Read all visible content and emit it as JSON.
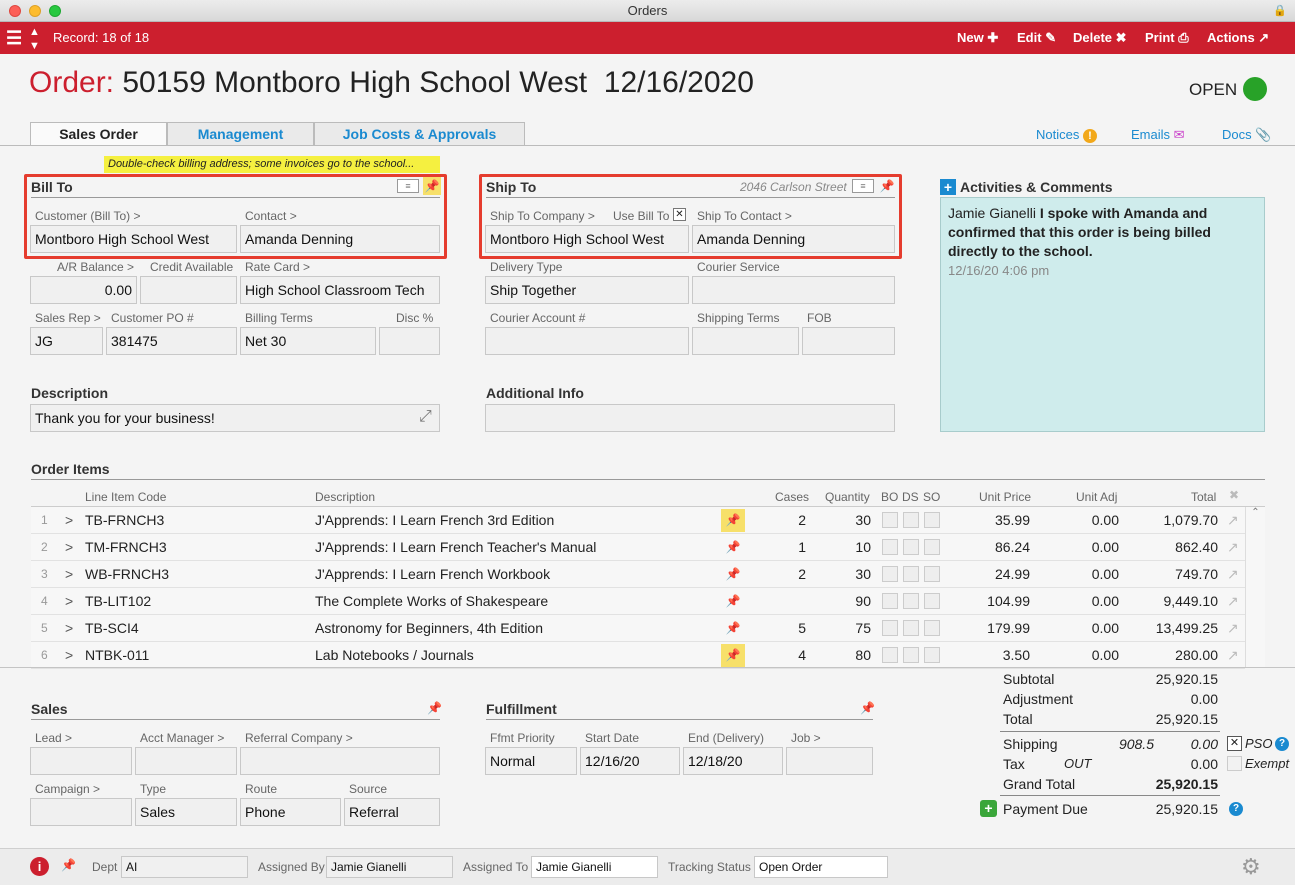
{
  "window": {
    "title": "Orders"
  },
  "toolbar": {
    "record": "Record: 18 of 18",
    "new": "New",
    "edit": "Edit",
    "delete": "Delete",
    "print": "Print",
    "actions": "Actions"
  },
  "header": {
    "prefix": "Order:",
    "title": "50159 Montboro High School West  12/16/2020",
    "status": "OPEN",
    "status_color": "#28a228"
  },
  "tabs": [
    "Sales Order",
    "Management",
    "Job Costs & Approvals"
  ],
  "links": {
    "notices": "Notices",
    "emails": "Emails",
    "docs": "Docs"
  },
  "note": "Double-check billing address; some invoices go to the school...",
  "bill_to": {
    "title": "Bill To",
    "customer_label": "Customer (Bill To) >",
    "customer": "Montboro High School West",
    "contact_label": "Contact >",
    "contact": "Amanda Denning",
    "ar_label": "A/R Balance >",
    "ar": "0.00",
    "credit_label": "Credit Available",
    "credit": "",
    "ratecard_label": "Rate Card >",
    "ratecard": "High School Classroom Tech",
    "salesrep_label": "Sales Rep >",
    "salesrep": "JG",
    "po_label": "Customer PO #",
    "po": "381475",
    "terms_label": "Billing Terms",
    "terms": "Net 30",
    "disc_label": "Disc %",
    "disc": ""
  },
  "ship_to": {
    "title": "Ship To",
    "address": "2046 Carlson Street",
    "company_label": "Ship To Company >",
    "use_bill_label": "Use Bill To",
    "company": "Montboro High School West",
    "contact_label": "Ship To Contact >",
    "contact": "Amanda Denning",
    "delivery_label": "Delivery Type",
    "delivery": "Ship Together",
    "courier_label": "Courier Service",
    "courier": "",
    "account_label": "Courier Account #",
    "account": "",
    "shipterms_label": "Shipping Terms",
    "shipterms": "",
    "fob_label": "FOB",
    "fob": ""
  },
  "activities": {
    "title": "Activities & Comments",
    "author": "Jamie Gianelli",
    "text": "I spoke with Amanda and confirmed that this order is being billed directly to the school.",
    "date": "12/16/20  4:06 pm"
  },
  "description": {
    "label": "Description",
    "value": "Thank you for your business!"
  },
  "additional": {
    "label": "Additional Info",
    "value": ""
  },
  "order_items": {
    "title": "Order Items",
    "columns": {
      "code": "Line Item Code",
      "desc": "Description",
      "cases": "Cases",
      "qty": "Quantity",
      "bo": "BO",
      "ds": "DS",
      "so": "SO",
      "price": "Unit Price",
      "adj": "Unit Adj",
      "total": "Total"
    },
    "rows": [
      {
        "n": "1",
        "code": "TB-FRNCH3",
        "desc": "J'Apprends: I Learn French 3rd Edition",
        "pinned": true,
        "cases": "2",
        "qty": "30",
        "price": "35.99",
        "adj": "0.00",
        "total": "1,079.70"
      },
      {
        "n": "2",
        "code": "TM-FRNCH3",
        "desc": "J'Apprends: I Learn French Teacher's Manual",
        "pinned": false,
        "cases": "1",
        "qty": "10",
        "price": "86.24",
        "adj": "0.00",
        "total": "862.40"
      },
      {
        "n": "3",
        "code": "WB-FRNCH3",
        "desc": "J'Apprends: I Learn French Workbook",
        "pinned": false,
        "cases": "2",
        "qty": "30",
        "price": "24.99",
        "adj": "0.00",
        "total": "749.70"
      },
      {
        "n": "4",
        "code": "TB-LIT102",
        "desc": "The Complete Works of Shakespeare",
        "pinned": false,
        "cases": "",
        "qty": "90",
        "price": "104.99",
        "adj": "0.00",
        "total": "9,449.10"
      },
      {
        "n": "5",
        "code": "TB-SCI4",
        "desc": "Astronomy for Beginners, 4th Edition",
        "pinned": false,
        "cases": "5",
        "qty": "75",
        "price": "179.99",
        "adj": "0.00",
        "total": "13,499.25"
      },
      {
        "n": "6",
        "code": "NTBK-011",
        "desc": "Lab Notebooks / Journals",
        "pinned": true,
        "cases": "4",
        "qty": "80",
        "price": "3.50",
        "adj": "0.00",
        "total": "280.00"
      }
    ]
  },
  "totals": {
    "subtotal_label": "Subtotal",
    "subtotal": "25,920.15",
    "adjustment_label": "Adjustment",
    "adjustment": "0.00",
    "total_label": "Total",
    "total": "25,920.15",
    "shipping_label": "Shipping",
    "shipping_weight": "908.5",
    "shipping": "0.00",
    "pso": "PSO",
    "tax_label": "Tax",
    "tax_code": "OUT",
    "tax": "0.00",
    "exempt": "Exempt",
    "grand_label": "Grand Total",
    "grand": "25,920.15",
    "due_label": "Payment Due",
    "due": "25,920.15"
  },
  "sales": {
    "title": "Sales",
    "lead_label": "Lead >",
    "lead": "",
    "acct_label": "Acct Manager >",
    "acct": "",
    "referral_label": "Referral Company >",
    "referral": "",
    "campaign_label": "Campaign >",
    "campaign": "",
    "type_label": "Type",
    "type": "Sales",
    "route_label": "Route",
    "route": "Phone",
    "source_label": "Source",
    "source": "Referral"
  },
  "fulfillment": {
    "title": "Fulfillment",
    "priority_label": "Ffmt Priority",
    "priority": "Normal",
    "start_label": "Start Date",
    "start": "12/16/20",
    "end_label": "End (Delivery)",
    "end": "12/18/20",
    "job_label": "Job >",
    "job": ""
  },
  "footer": {
    "dept_label": "Dept",
    "dept": "AI",
    "assigned_by_label": "Assigned By",
    "assigned_by": "Jamie Gianelli",
    "assigned_to_label": "Assigned To",
    "assigned_to": "Jamie Gianelli",
    "tracking_label": "Tracking Status",
    "tracking": "Open Order"
  }
}
